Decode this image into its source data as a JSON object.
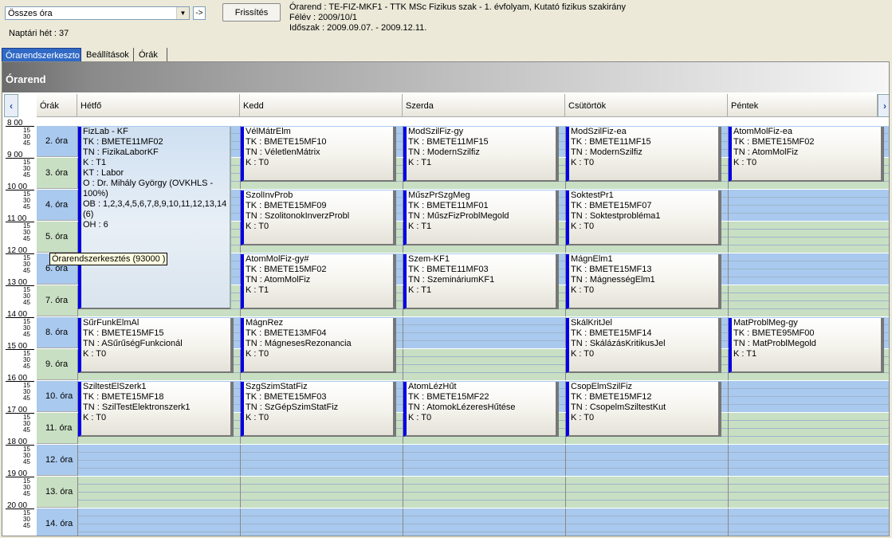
{
  "toolbar": {
    "combo_value": "Összes óra",
    "combo_arrow": "▼",
    "go_label": "->",
    "refresh_label": "Frissítés",
    "week_label": "Naptári hét : 37"
  },
  "info": {
    "line1": "Órarend : TE-FIZ-MKF1 - TTK MSc Fizikus szak - 1. évfolyam, Kutató fizikus szakirány",
    "line2": "Félév : 2009/10/1",
    "line3": "Időszak : 2009.09.07. - 2009.12.11."
  },
  "tabs": [
    "Órarendszerkeszto",
    "Beállítások",
    "Órák"
  ],
  "banner_title": "Órarend",
  "header": {
    "hours_col": "Órák",
    "days": [
      "Hétfő",
      "Kedd",
      "Szerda",
      "Csütörtök",
      "Péntek"
    ],
    "prev": "‹",
    "next": "›"
  },
  "time_labels": [
    {
      "hour": "8 00",
      "q": [
        "15",
        "30",
        "45"
      ]
    },
    {
      "hour": "9 00",
      "q": [
        "15",
        "30",
        "45"
      ]
    },
    {
      "hour": "10 00",
      "q": [
        "15",
        "30",
        "45"
      ]
    },
    {
      "hour": "11 00",
      "q": [
        "15",
        "30",
        "45"
      ]
    },
    {
      "hour": "12 00",
      "q": [
        "15",
        "30",
        "45"
      ]
    },
    {
      "hour": "13 00",
      "q": [
        "15",
        "30",
        "45"
      ]
    },
    {
      "hour": "14 00",
      "q": [
        "15",
        "30",
        "45"
      ]
    },
    {
      "hour": "15 00",
      "q": [
        "15",
        "30",
        "45"
      ]
    },
    {
      "hour": "16 00",
      "q": [
        "15",
        "30",
        "45"
      ]
    },
    {
      "hour": "17 00",
      "q": [
        "15",
        "30",
        "45"
      ]
    },
    {
      "hour": "18 00",
      "q": [
        "15",
        "30",
        "45"
      ]
    },
    {
      "hour": "19 00",
      "q": [
        "15",
        "30",
        "45"
      ]
    },
    {
      "hour": "20 00",
      "q": [
        "15",
        "30",
        "45"
      ]
    }
  ],
  "hour_slots": [
    "2. óra",
    "3. óra",
    "4. óra",
    "5. óra",
    "6. óra",
    "7. óra",
    "8. óra",
    "9. óra",
    "10. óra",
    "11. óra",
    "12. óra",
    "13. óra",
    "14. óra"
  ],
  "colors": {
    "slot_odd": "#A9C9EE",
    "slot_even": "#C8DFC3",
    "event_border": "#0000E8"
  },
  "events": [
    {
      "day": 0,
      "start": 0,
      "span": 6,
      "selected": true,
      "lines": [
        "FizLab - KF",
        "TK : BMETE11MF02",
        "TN : FizikaLaborKF",
        "K : T1",
        "KT : Labor",
        "O : Dr. Mihály György (OVKHLS - 100%)",
        "OB : 1,2,3,4,5,6,7,8,9,10,11,12,13,14 (6)",
        "OH : 6"
      ]
    },
    {
      "day": 1,
      "start": 0,
      "span": 2,
      "lines": [
        "VélMátrElm",
        "TK : BMETE15MF10",
        "TN : VéletlenMátrix",
        "K : T0"
      ]
    },
    {
      "day": 2,
      "start": 0,
      "span": 2,
      "lines": [
        "ModSzilFiz-gy",
        "TK : BMETE11MF15",
        "TN : ModernSzilfiz",
        "K : T1"
      ]
    },
    {
      "day": 3,
      "start": 0,
      "span": 2,
      "lines": [
        "ModSzilFiz-ea",
        "TK : BMETE11MF15",
        "TN : ModernSzilfiz",
        "K : T0"
      ]
    },
    {
      "day": 4,
      "start": 0,
      "span": 2,
      "lines": [
        "AtomMolFiz-ea",
        "TK : BMETE15MF02",
        "TN : AtomMolFiz",
        "K : T0"
      ]
    },
    {
      "day": 1,
      "start": 2,
      "span": 2,
      "lines": [
        "SzolInvProb",
        "TK : BMETE15MF09",
        "TN : SzolitonokInverzProbl",
        "K : T0"
      ]
    },
    {
      "day": 2,
      "start": 2,
      "span": 2,
      "lines": [
        "MűszPrSzgMeg",
        "TK : BMETE11MF01",
        "TN : MűszFizProblMegold",
        "K : T1"
      ]
    },
    {
      "day": 3,
      "start": 2,
      "span": 2,
      "lines": [
        "SoktestPr1",
        "TK : BMETE15MF07",
        "TN : Soktestprobléma1",
        "K : T0"
      ]
    },
    {
      "day": 1,
      "start": 4,
      "span": 2,
      "lines": [
        "AtomMolFiz-gy#",
        "TK : BMETE15MF02",
        "TN : AtomMolFiz",
        "K : T1"
      ]
    },
    {
      "day": 2,
      "start": 4,
      "span": 2,
      "lines": [
        "Szem-KF1",
        "TK : BMETE11MF03",
        "TN : SzemináriumKF1",
        "K : T1"
      ]
    },
    {
      "day": 3,
      "start": 4,
      "span": 2,
      "lines": [
        "MágnElm1",
        "TK : BMETE15MF13",
        "TN : MágnességElm1",
        "K : T0"
      ]
    },
    {
      "day": 0,
      "start": 6,
      "span": 2,
      "lines": [
        "SűrFunkElmAl",
        "TK : BMETE15MF15",
        "TN : ASűrűségFunkcionál",
        "K : T0"
      ]
    },
    {
      "day": 1,
      "start": 6,
      "span": 2,
      "lines": [
        "MágnRez",
        "TK : BMETE13MF04",
        "TN : MágnesesRezonancia",
        "K : T0"
      ]
    },
    {
      "day": 3,
      "start": 6,
      "span": 2,
      "lines": [
        "SkálKritJel",
        "TK : BMETE15MF14",
        "TN : SkálázásKritikusJel",
        "K : T0"
      ]
    },
    {
      "day": 4,
      "start": 6,
      "span": 2,
      "lines": [
        "MatProblMeg-gy",
        "TK : BMETE95MF00",
        "TN : MatProblMegold",
        "K : T1"
      ]
    },
    {
      "day": 0,
      "start": 8,
      "span": 2,
      "lines": [
        "SziltestElSzerk1",
        "TK : BMETE15MF18",
        "TN : SzilTestElektronszerk1",
        "K : T0"
      ]
    },
    {
      "day": 1,
      "start": 8,
      "span": 2,
      "lines": [
        "SzgSzimStatFiz",
        "TK : BMETE15MF03",
        "TN : SzGépSzimStatFiz",
        "K : T0"
      ]
    },
    {
      "day": 2,
      "start": 8,
      "span": 2,
      "lines": [
        "AtomLézHűt",
        "TK : BMETE15MF22",
        "TN : AtomokLézeresHűtése",
        "K : T0"
      ]
    },
    {
      "day": 3,
      "start": 8,
      "span": 2,
      "lines": [
        "CsopElmSzilFiz",
        "TK : BMETE15MF12",
        "TN : CsopelmSziltestKut",
        "K : T0"
      ]
    }
  ],
  "tooltip": "Órarendszerkesztés (93000 )"
}
